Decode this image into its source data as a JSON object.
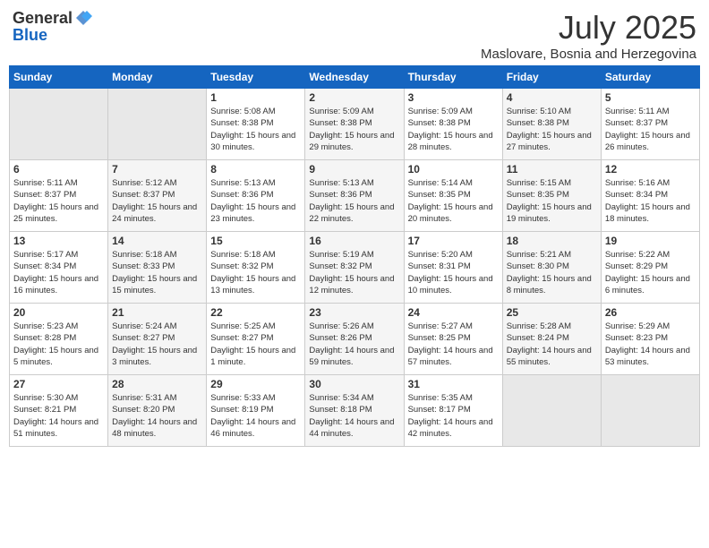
{
  "header": {
    "logo_general": "General",
    "logo_blue": "Blue",
    "month_year": "July 2025",
    "location": "Maslovare, Bosnia and Herzegovina"
  },
  "weekdays": [
    "Sunday",
    "Monday",
    "Tuesday",
    "Wednesday",
    "Thursday",
    "Friday",
    "Saturday"
  ],
  "weeks": [
    [
      {
        "day": "",
        "empty": true
      },
      {
        "day": "",
        "empty": true
      },
      {
        "day": "1",
        "sunrise": "5:08 AM",
        "sunset": "8:38 PM",
        "daylight": "15 hours and 30 minutes."
      },
      {
        "day": "2",
        "sunrise": "5:09 AM",
        "sunset": "8:38 PM",
        "daylight": "15 hours and 29 minutes."
      },
      {
        "day": "3",
        "sunrise": "5:09 AM",
        "sunset": "8:38 PM",
        "daylight": "15 hours and 28 minutes."
      },
      {
        "day": "4",
        "sunrise": "5:10 AM",
        "sunset": "8:38 PM",
        "daylight": "15 hours and 27 minutes."
      },
      {
        "day": "5",
        "sunrise": "5:11 AM",
        "sunset": "8:37 PM",
        "daylight": "15 hours and 26 minutes."
      }
    ],
    [
      {
        "day": "6",
        "sunrise": "5:11 AM",
        "sunset": "8:37 PM",
        "daylight": "15 hours and 25 minutes."
      },
      {
        "day": "7",
        "sunrise": "5:12 AM",
        "sunset": "8:37 PM",
        "daylight": "15 hours and 24 minutes."
      },
      {
        "day": "8",
        "sunrise": "5:13 AM",
        "sunset": "8:36 PM",
        "daylight": "15 hours and 23 minutes."
      },
      {
        "day": "9",
        "sunrise": "5:13 AM",
        "sunset": "8:36 PM",
        "daylight": "15 hours and 22 minutes."
      },
      {
        "day": "10",
        "sunrise": "5:14 AM",
        "sunset": "8:35 PM",
        "daylight": "15 hours and 20 minutes."
      },
      {
        "day": "11",
        "sunrise": "5:15 AM",
        "sunset": "8:35 PM",
        "daylight": "15 hours and 19 minutes."
      },
      {
        "day": "12",
        "sunrise": "5:16 AM",
        "sunset": "8:34 PM",
        "daylight": "15 hours and 18 minutes."
      }
    ],
    [
      {
        "day": "13",
        "sunrise": "5:17 AM",
        "sunset": "8:34 PM",
        "daylight": "15 hours and 16 minutes."
      },
      {
        "day": "14",
        "sunrise": "5:18 AM",
        "sunset": "8:33 PM",
        "daylight": "15 hours and 15 minutes."
      },
      {
        "day": "15",
        "sunrise": "5:18 AM",
        "sunset": "8:32 PM",
        "daylight": "15 hours and 13 minutes."
      },
      {
        "day": "16",
        "sunrise": "5:19 AM",
        "sunset": "8:32 PM",
        "daylight": "15 hours and 12 minutes."
      },
      {
        "day": "17",
        "sunrise": "5:20 AM",
        "sunset": "8:31 PM",
        "daylight": "15 hours and 10 minutes."
      },
      {
        "day": "18",
        "sunrise": "5:21 AM",
        "sunset": "8:30 PM",
        "daylight": "15 hours and 8 minutes."
      },
      {
        "day": "19",
        "sunrise": "5:22 AM",
        "sunset": "8:29 PM",
        "daylight": "15 hours and 6 minutes."
      }
    ],
    [
      {
        "day": "20",
        "sunrise": "5:23 AM",
        "sunset": "8:28 PM",
        "daylight": "15 hours and 5 minutes."
      },
      {
        "day": "21",
        "sunrise": "5:24 AM",
        "sunset": "8:27 PM",
        "daylight": "15 hours and 3 minutes."
      },
      {
        "day": "22",
        "sunrise": "5:25 AM",
        "sunset": "8:27 PM",
        "daylight": "15 hours and 1 minute."
      },
      {
        "day": "23",
        "sunrise": "5:26 AM",
        "sunset": "8:26 PM",
        "daylight": "14 hours and 59 minutes."
      },
      {
        "day": "24",
        "sunrise": "5:27 AM",
        "sunset": "8:25 PM",
        "daylight": "14 hours and 57 minutes."
      },
      {
        "day": "25",
        "sunrise": "5:28 AM",
        "sunset": "8:24 PM",
        "daylight": "14 hours and 55 minutes."
      },
      {
        "day": "26",
        "sunrise": "5:29 AM",
        "sunset": "8:23 PM",
        "daylight": "14 hours and 53 minutes."
      }
    ],
    [
      {
        "day": "27",
        "sunrise": "5:30 AM",
        "sunset": "8:21 PM",
        "daylight": "14 hours and 51 minutes."
      },
      {
        "day": "28",
        "sunrise": "5:31 AM",
        "sunset": "8:20 PM",
        "daylight": "14 hours and 48 minutes."
      },
      {
        "day": "29",
        "sunrise": "5:33 AM",
        "sunset": "8:19 PM",
        "daylight": "14 hours and 46 minutes."
      },
      {
        "day": "30",
        "sunrise": "5:34 AM",
        "sunset": "8:18 PM",
        "daylight": "14 hours and 44 minutes."
      },
      {
        "day": "31",
        "sunrise": "5:35 AM",
        "sunset": "8:17 PM",
        "daylight": "14 hours and 42 minutes."
      },
      {
        "day": "",
        "empty": true
      },
      {
        "day": "",
        "empty": true
      }
    ]
  ]
}
